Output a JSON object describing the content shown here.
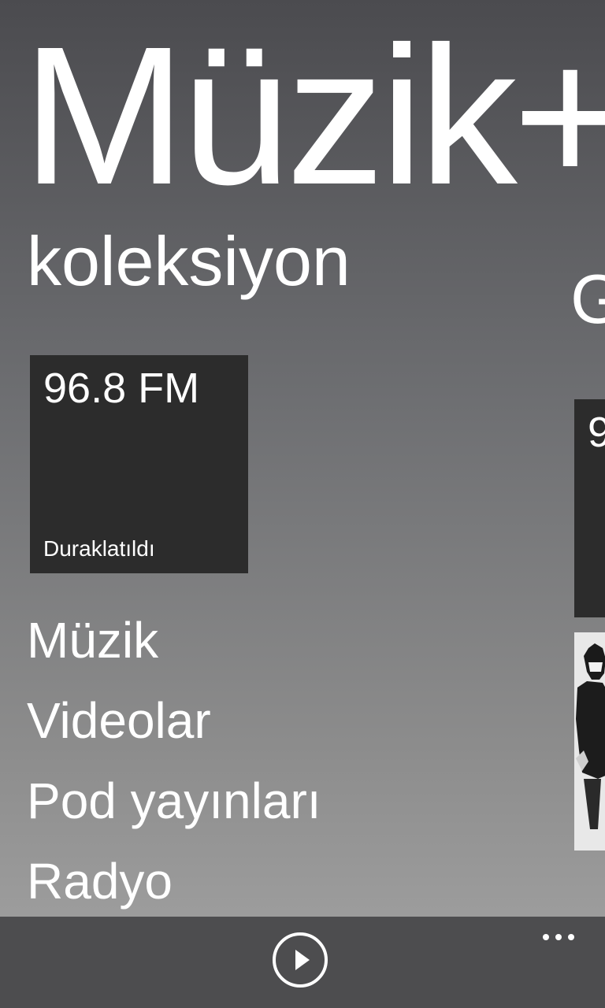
{
  "app": {
    "title": "Müzik+"
  },
  "section": {
    "title": "koleksiyon",
    "next_peek": "G"
  },
  "now_playing": {
    "station": "96.8 FM",
    "status": "Duraklatıldı"
  },
  "peek_tile": {
    "text": "9"
  },
  "nav": {
    "items": [
      {
        "label": "Müzik"
      },
      {
        "label": "Videolar"
      },
      {
        "label": "Pod yayınları"
      },
      {
        "label": "Radyo"
      }
    ]
  },
  "app_bar": {
    "play_icon": "play-icon",
    "more_icon": "ellipsis-icon"
  }
}
